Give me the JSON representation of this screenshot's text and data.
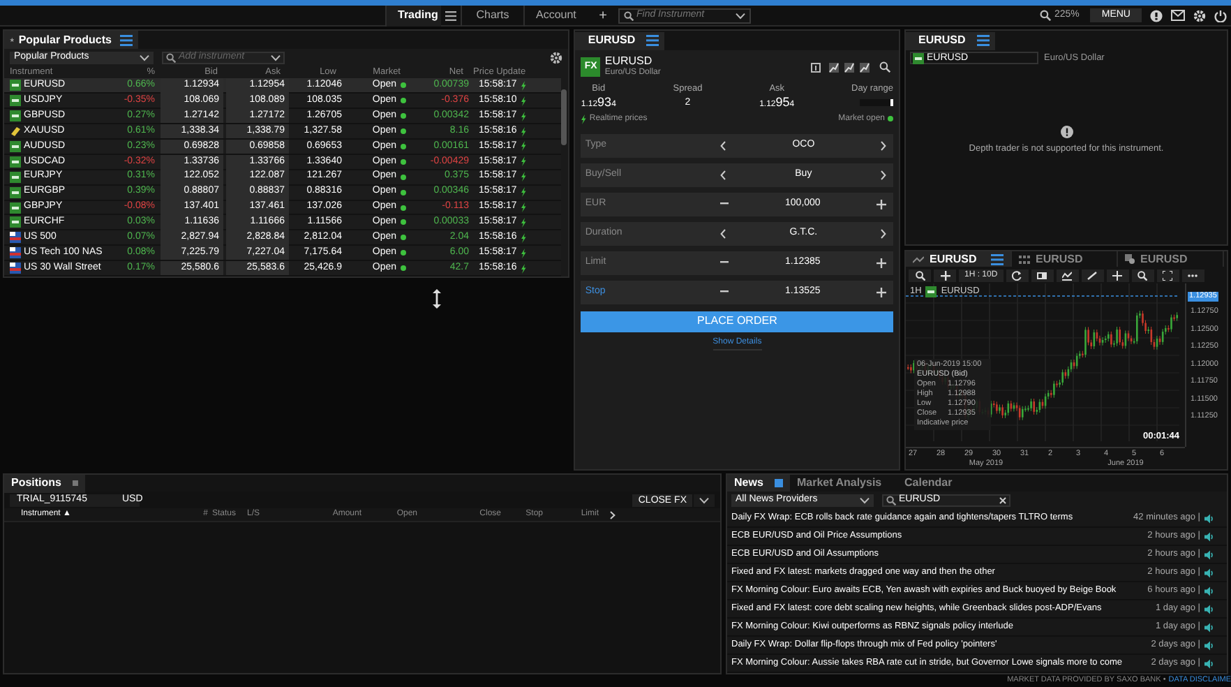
{
  "top_bar": {
    "tabs": [
      {
        "label": "Trading",
        "selected": true
      },
      {
        "label": "Charts",
        "selected": false
      },
      {
        "label": "Account",
        "selected": false
      }
    ],
    "add": "+",
    "find_placeholder": "Find Instrument",
    "zoom": "225%",
    "menu": "MENU"
  },
  "products": {
    "title": "Popular Products",
    "list_select": "Popular Products",
    "add_placeholder": "Add instrument",
    "columns": [
      "Instrument",
      "%",
      "Bid",
      "Ask",
      "Low",
      "Market",
      "Net",
      "Price Update"
    ],
    "rows": [
      {
        "kind": "fx",
        "instrument": "EURUSD",
        "pct": "0.66%",
        "bid": "1.12934",
        "ask": "1.12954",
        "low": "1.12046",
        "market": "Open",
        "net": "0.00739",
        "time": "15:58:17",
        "negative": false,
        "selected": true
      },
      {
        "kind": "fx",
        "instrument": "USDJPY",
        "pct": "-0.35%",
        "bid": "108.069",
        "ask": "108.089",
        "low": "108.035",
        "market": "Open",
        "net": "-0.376",
        "time": "15:58:10",
        "negative": true,
        "selected": false
      },
      {
        "kind": "fx",
        "instrument": "GBPUSD",
        "pct": "0.27%",
        "bid": "1.27142",
        "ask": "1.27172",
        "low": "1.26705",
        "market": "Open",
        "net": "0.00342",
        "time": "15:58:17",
        "negative": false,
        "selected": false
      },
      {
        "kind": "metal",
        "instrument": "XAUUSD",
        "pct": "0.61%",
        "bid": "1,338.34",
        "ask": "1,338.79",
        "low": "1,327.58",
        "market": "Open",
        "net": "8.16",
        "time": "15:58:16",
        "negative": false,
        "selected": false
      },
      {
        "kind": "fx",
        "instrument": "AUDUSD",
        "pct": "0.23%",
        "bid": "0.69828",
        "ask": "0.69858",
        "low": "0.69653",
        "market": "Open",
        "net": "0.00161",
        "time": "15:58:17",
        "negative": false,
        "selected": false
      },
      {
        "kind": "fx",
        "instrument": "USDCAD",
        "pct": "-0.32%",
        "bid": "1.33736",
        "ask": "1.33766",
        "low": "1.33640",
        "market": "Open",
        "net": "-0.00429",
        "time": "15:58:17",
        "negative": true,
        "selected": false
      },
      {
        "kind": "fx",
        "instrument": "EURJPY",
        "pct": "0.31%",
        "bid": "122.052",
        "ask": "122.087",
        "low": "121.267",
        "market": "Open",
        "net": "0.375",
        "time": "15:58:17",
        "negative": false,
        "selected": false
      },
      {
        "kind": "fx",
        "instrument": "EURGBP",
        "pct": "0.39%",
        "bid": "0.88807",
        "ask": "0.88837",
        "low": "0.88316",
        "market": "Open",
        "net": "0.00346",
        "time": "15:58:17",
        "negative": false,
        "selected": false
      },
      {
        "kind": "fx",
        "instrument": "GBPJPY",
        "pct": "-0.08%",
        "bid": "137.401",
        "ask": "137.461",
        "low": "137.026",
        "market": "Open",
        "net": "-0.113",
        "time": "15:58:17",
        "negative": true,
        "selected": false
      },
      {
        "kind": "fx",
        "instrument": "EURCHF",
        "pct": "0.03%",
        "bid": "1.11636",
        "ask": "1.11666",
        "low": "1.11566",
        "market": "Open",
        "net": "0.00033",
        "time": "15:58:17",
        "negative": false,
        "selected": false
      },
      {
        "kind": "cfd",
        "instrument": "US 500",
        "pct": "0.07%",
        "bid": "2,827.94",
        "ask": "2,828.84",
        "low": "2,812.04",
        "market": "Open",
        "net": "2.04",
        "time": "15:58:16",
        "negative": false,
        "selected": false
      },
      {
        "kind": "cfd",
        "instrument": "US Tech 100 NAS",
        "pct": "0.08%",
        "bid": "7,225.79",
        "ask": "7,227.04",
        "low": "7,175.64",
        "market": "Open",
        "net": "6.00",
        "time": "15:58:17",
        "negative": false,
        "selected": false
      },
      {
        "kind": "cfd",
        "instrument": "US 30 Wall Street",
        "pct": "0.17%",
        "bid": "25,580.6",
        "ask": "25,583.6",
        "low": "25,426.9",
        "market": "Open",
        "net": "42.7",
        "time": "15:58:16",
        "negative": false,
        "selected": false
      }
    ]
  },
  "ticket": {
    "tab": "EURUSD",
    "badge": "FX",
    "symbol": "EURUSD",
    "description": "Euro/US Dollar",
    "quotes": [
      {
        "label": "Bid",
        "lead": "1.12",
        "big": "93",
        "pip": "4"
      },
      {
        "label": "Spread",
        "value": "2"
      },
      {
        "label": "Ask",
        "lead": "1.12",
        "big": "95",
        "pip": "4"
      },
      {
        "label": "Day range"
      }
    ],
    "realtime": "Realtime prices",
    "market_status": "Market open",
    "fields": [
      {
        "kind": "select",
        "label": "Type",
        "value": "OCO",
        "highlighted": false
      },
      {
        "kind": "select",
        "label": "Buy/Sell",
        "value": "Buy",
        "highlighted": false
      },
      {
        "kind": "stepper",
        "label": "EUR",
        "value": "100,000",
        "highlighted": false
      },
      {
        "kind": "select",
        "label": "Duration",
        "value": "G.T.C.",
        "highlighted": false
      },
      {
        "kind": "stepper",
        "label": "Limit",
        "value": "1.12385",
        "highlighted": false
      },
      {
        "kind": "stepper",
        "label": "Stop",
        "value": "1.13525",
        "highlighted": true
      }
    ],
    "place_order": "PLACE ORDER",
    "show_details": "Show Details"
  },
  "depth": {
    "tab": "EURUSD",
    "symbol": "EURUSD",
    "description": "Euro/US Dollar",
    "message": "Depth trader is not supported for this instrument."
  },
  "chart": {
    "tabs": [
      {
        "label": "EURUSD",
        "kind": "line",
        "selected": true
      },
      {
        "label": "EURUSD",
        "kind": "grid",
        "selected": false
      },
      {
        "label": "EURUSD",
        "kind": "tag",
        "selected": false
      }
    ],
    "interval_button": "1H : 10D",
    "interval": "1H",
    "symbol": "EURUSD",
    "price_labels": [
      "1.12750",
      "1.12500",
      "1.12250",
      "1.12000",
      "1.11750",
      "1.11500",
      "1.11250"
    ],
    "current_price": "1.12935",
    "day_labels": [
      "27",
      "28",
      "29",
      "30",
      "31",
      "2",
      "3",
      "4",
      "5",
      "6"
    ],
    "month_labels": [
      "May 2019",
      "June 2019"
    ],
    "tooltip": {
      "date": "06-Jun-2019 15:00",
      "title": "EURUSD (Bid)",
      "rows": [
        {
          "label": "Open",
          "value": "1.12796"
        },
        {
          "label": "High",
          "value": "1.12988"
        },
        {
          "label": "Low",
          "value": "1.12790"
        },
        {
          "label": "Close",
          "value": "1.12935"
        }
      ],
      "note": "Indicative price"
    },
    "countdown": "00:01:44"
  },
  "positions": {
    "title": "Positions",
    "account": "TRIAL_9115745",
    "currency": "USD",
    "close_button": "CLOSE FX",
    "columns": [
      "Instrument ▲",
      "#",
      "Status",
      "L/S",
      "Amount",
      "Open",
      "Close",
      "Stop",
      "Limit"
    ]
  },
  "news": {
    "tabs": [
      {
        "label": "News",
        "selected": true
      },
      {
        "label": "Market Analysis",
        "selected": false
      },
      {
        "label": "Calendar",
        "selected": false
      }
    ],
    "provider": "All News Providers",
    "search": "EURUSD",
    "items": [
      {
        "headline": "Daily FX Wrap: ECB rolls back rate guidance again and tightens/tapers TLTRO terms",
        "age": "42 minutes ago |"
      },
      {
        "headline": "ECB EUR/USD and Oil Price Assumptions",
        "age": "2 hours ago |"
      },
      {
        "headline": "ECB EUR/USD and Oil Assumptions",
        "age": "2 hours ago |"
      },
      {
        "headline": "Fixed and FX latest: markets dragged one way and then the other",
        "age": "2 hours ago |"
      },
      {
        "headline": "FX Morning Colour: Euro awaits ECB, Yen awash with expiries and Buck buoyed by Beige Book",
        "age": "6 hours ago |"
      },
      {
        "headline": "Fixed and FX latest: core debt scaling new heights, while Greenback slides post-ADP/Evans",
        "age": "1 day ago |"
      },
      {
        "headline": "FX Morning Colour: Kiwi outperforms as RBNZ signals policy interlude",
        "age": "1 day ago |"
      },
      {
        "headline": "Daily FX Wrap: Dollar flip-flops through mix of Fed policy 'pointers'",
        "age": "2 days ago |"
      },
      {
        "headline": "FX Morning Colour: Aussie takes RBA rate cut in stride, but Governor Lowe signals more to come",
        "age": "2 days ago |"
      }
    ]
  },
  "footer": {
    "text": "MARKET DATA PROVIDED BY SAXO BANK •",
    "link": "DATA DISCLAIME"
  }
}
